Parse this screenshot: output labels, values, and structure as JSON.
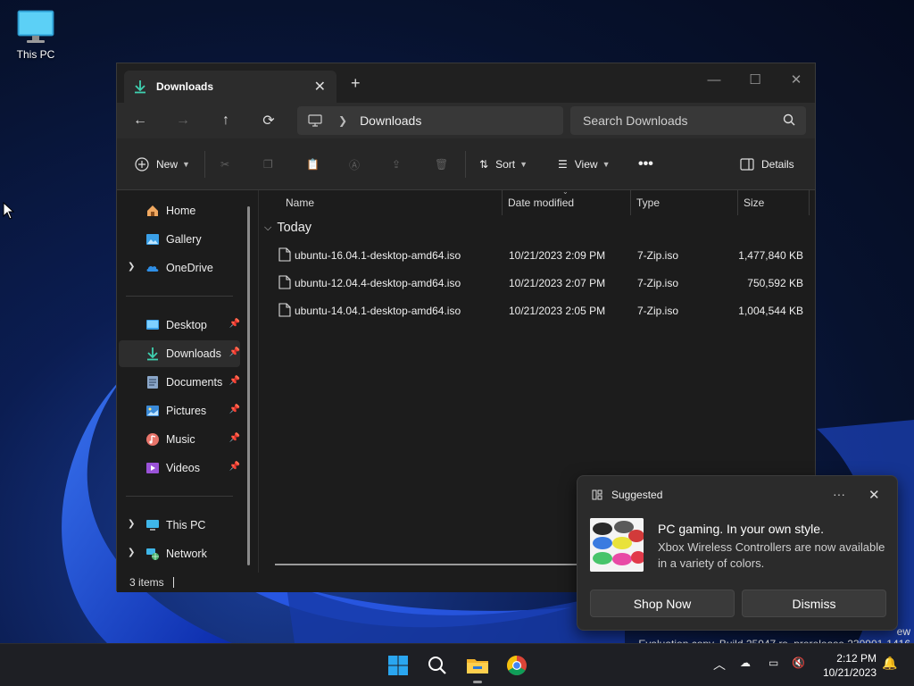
{
  "desktop": {
    "icon_label": "This PC"
  },
  "window": {
    "tab_title": "Downloads",
    "address": {
      "crumb": "Downloads"
    },
    "search_placeholder": "Search Downloads",
    "toolbar": {
      "new_label": "New",
      "sort_label": "Sort",
      "view_label": "View",
      "details_label": "Details"
    },
    "sidebar": {
      "home": "Home",
      "gallery": "Gallery",
      "onedrive": "OneDrive",
      "desktop": "Desktop",
      "downloads": "Downloads",
      "documents": "Documents",
      "pictures": "Pictures",
      "music": "Music",
      "videos": "Videos",
      "thispc": "This PC",
      "network": "Network"
    },
    "columns": {
      "name": "Name",
      "date": "Date modified",
      "type": "Type",
      "size": "Size"
    },
    "group_label": "Today",
    "files": [
      {
        "name": "ubuntu-16.04.1-desktop-amd64.iso",
        "date": "10/21/2023 2:09 PM",
        "type": "7-Zip.iso",
        "size": "1,477,840 KB"
      },
      {
        "name": "ubuntu-12.04.4-desktop-amd64.iso",
        "date": "10/21/2023 2:07 PM",
        "type": "7-Zip.iso",
        "size": "750,592 KB"
      },
      {
        "name": "ubuntu-14.04.1-desktop-amd64.iso",
        "date": "10/21/2023 2:05 PM",
        "type": "7-Zip.iso",
        "size": "1,004,544 KB"
      }
    ],
    "status": "3 items"
  },
  "toast": {
    "header": "Suggested",
    "headline": "PC gaming. In your own style.",
    "body": "Xbox Wireless Controllers are now available in a variety of colors.",
    "primary_button": "Shop Now",
    "secondary_button": "Dismiss"
  },
  "watermark": {
    "line1": "ew",
    "line2": "Evaluation copy. Build 25947.rs_prerelease.230901-1416"
  },
  "taskbar": {
    "time": "2:12 PM",
    "date": "10/21/2023"
  },
  "colors": {
    "accent": "#0078d4",
    "window_bg": "#1c1c1c",
    "taskbar_bg": "#1e1f24"
  }
}
